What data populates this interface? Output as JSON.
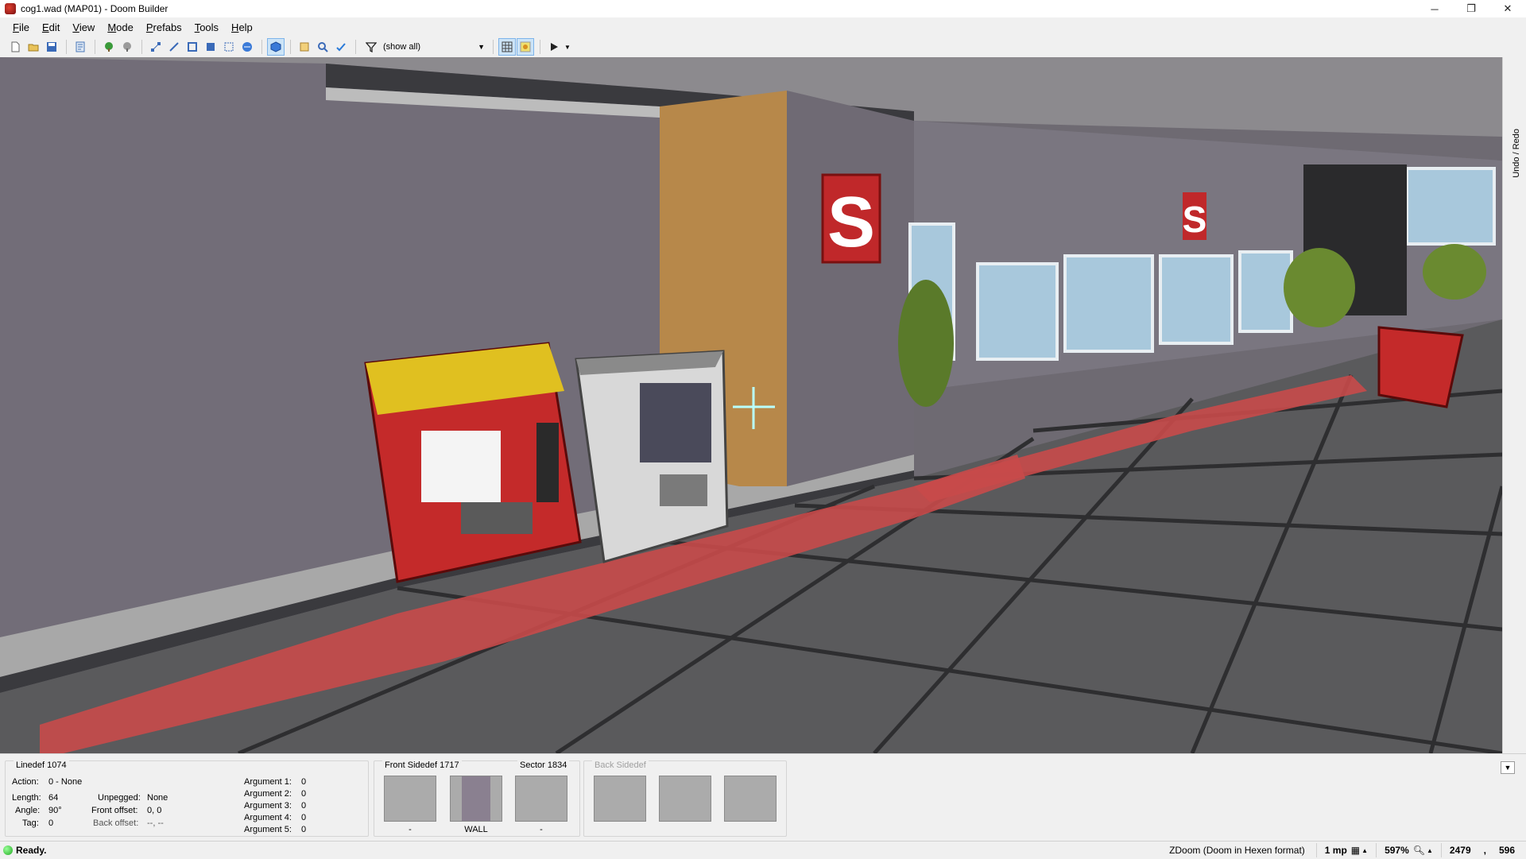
{
  "window": {
    "title": "cog1.wad (MAP01) - Doom Builder",
    "minimize": "─",
    "restore": "❐",
    "close": "✕"
  },
  "menu": {
    "file": "File",
    "edit": "Edit",
    "view": "View",
    "mode": "Mode",
    "prefabs": "Prefabs",
    "tools": "Tools",
    "help": "Help"
  },
  "toolbar": {
    "filter_value": "(show all)"
  },
  "sidebar": {
    "undo_redo_label": "Undo / Redo"
  },
  "linedef": {
    "title": "Linedef 1074",
    "action_label": "Action:",
    "action_value": "0 - None",
    "length_label": "Length:",
    "length_value": "64",
    "angle_label": "Angle:",
    "angle_value": "90°",
    "tag_label": "Tag:",
    "tag_value": "0",
    "unpegged_label": "Unpegged:",
    "unpegged_value": "None",
    "front_offset_label": "Front offset:",
    "front_offset_value": "0, 0",
    "back_offset_label": "Back offset:",
    "back_offset_value": "--, --",
    "arguments": [
      {
        "label": "Argument 1:",
        "value": "0"
      },
      {
        "label": "Argument 2:",
        "value": "0"
      },
      {
        "label": "Argument 3:",
        "value": "0"
      },
      {
        "label": "Argument 4:",
        "value": "0"
      },
      {
        "label": "Argument 5:",
        "value": "0"
      }
    ]
  },
  "front_sidedef": {
    "title": "Front Sidedef 1717",
    "textures": [
      "-",
      "WALL",
      "-"
    ]
  },
  "sector": {
    "title": "Sector 1834"
  },
  "back_sidedef": {
    "title": "Back Sidedef"
  },
  "status": {
    "text": "Ready.",
    "engine": "ZDoom (Doom in Hexen format)",
    "grid": "1 mp",
    "zoom": "597%",
    "coord_x": "2479",
    "coord_sep": ",",
    "coord_y": "596"
  },
  "viewport": {
    "sign_letter": "S",
    "sign_color": "#c0282a",
    "wall_color": "#726d78",
    "floor_color": "#5a5a5c",
    "stripe_color": "#c84a4a",
    "crosshair_color": "#b8ffff"
  }
}
